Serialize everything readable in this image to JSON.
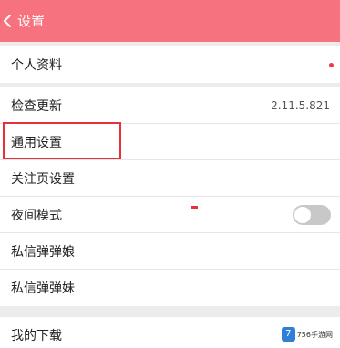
{
  "header": {
    "title": "设置",
    "back_icon": "chevron-left-icon",
    "color": "#f7727f"
  },
  "sections": {
    "profile": {
      "label": "个人资料",
      "has_notification_dot": true
    },
    "main": {
      "check_update": {
        "label": "检查更新",
        "value": "2.11.5.821"
      },
      "general_settings": {
        "label": "通用设置"
      },
      "follow_page_settings": {
        "label": "关注页设置"
      },
      "night_mode": {
        "label": "夜间模式",
        "toggle_on": false
      },
      "dm_bullet_girl": {
        "label": "私信弹弹娘"
      },
      "dm_bullet_sister": {
        "label": "私信弹弹妹"
      }
    },
    "downloads": {
      "label": "我的下载"
    }
  },
  "watermark": {
    "badge": "7",
    "text": "756手游网"
  },
  "colors": {
    "accent": "#f7727f",
    "highlight": "#e53238",
    "toggle_off": "#c8c8c8"
  }
}
